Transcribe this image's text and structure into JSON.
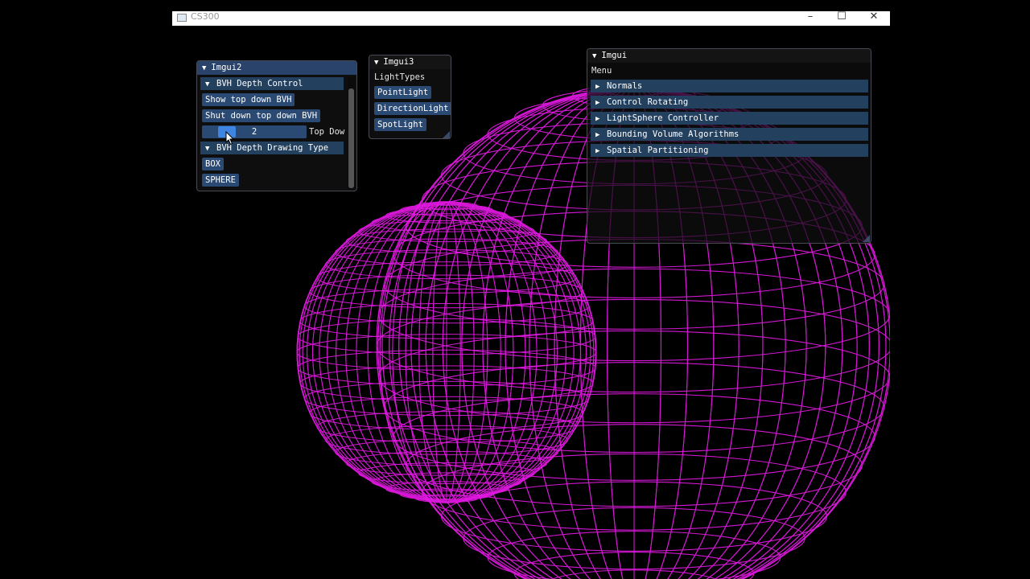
{
  "window": {
    "title": "CS300",
    "minimize_glyph": "–",
    "maximize_glyph": "☐",
    "close_glyph": "✕"
  },
  "scene": {
    "wire_color": "#e61ae6",
    "background": "#000000"
  },
  "imgui2": {
    "title": "Imgui2",
    "sections": {
      "bvh_depth_control": "BVH Depth Control",
      "bvh_depth_drawing_type": "BVH Depth Drawing Type"
    },
    "buttons": {
      "show_top_down": "Show top down BVH",
      "shut_down_top_down": "Shut down top down BVH",
      "box": "BOX",
      "sphere": "SPHERE"
    },
    "slider": {
      "value": "2",
      "label": "Top Dow"
    }
  },
  "imgui3": {
    "title": "Imgui3",
    "label": "LightTypes",
    "buttons": {
      "point": "PointLight",
      "direction": "DirectionLight",
      "spot": "SpotLight"
    }
  },
  "imgui": {
    "title": "Imgui",
    "menu_label": "Menu",
    "headers": [
      "Normals",
      "Control Rotating",
      "LightSphere Controller",
      "Bounding Volume Algorithms",
      "Spatial Partitioning"
    ]
  },
  "glyphs": {
    "expanded": "▼",
    "collapsed": "▶"
  },
  "colors": {
    "button": "#2a4a74",
    "header": "#23405f",
    "slider_grab": "#3d85e0",
    "window_bg": "#0f0f0f"
  }
}
